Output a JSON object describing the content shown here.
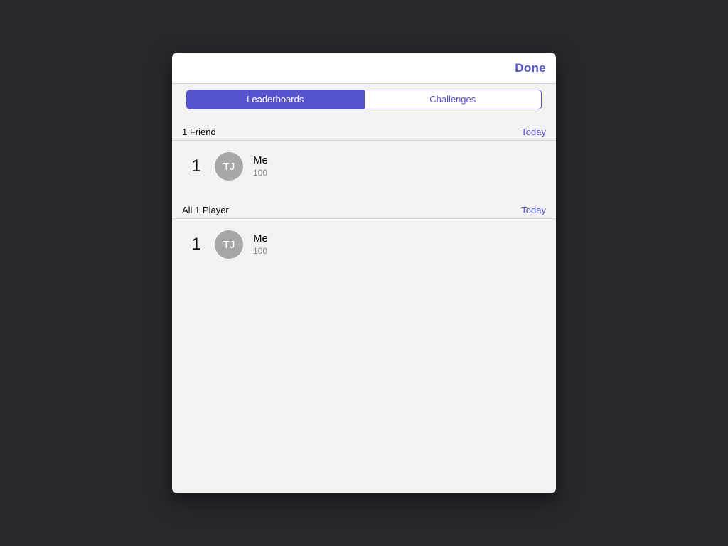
{
  "colors": {
    "accent": "#5753cf"
  },
  "nav": {
    "done_label": "Done"
  },
  "segments": {
    "leaderboards": "Leaderboards",
    "challenges": "Challenges",
    "active": "leaderboards"
  },
  "sections": [
    {
      "title": "1 Friend",
      "filter": "Today",
      "rows": [
        {
          "rank": "1",
          "initials": "TJ",
          "name": "Me",
          "score": "100"
        }
      ]
    },
    {
      "title": "All 1 Player",
      "filter": "Today",
      "rows": [
        {
          "rank": "1",
          "initials": "TJ",
          "name": "Me",
          "score": "100"
        }
      ]
    }
  ]
}
